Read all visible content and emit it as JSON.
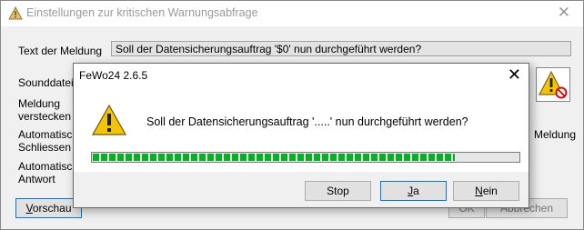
{
  "window": {
    "title": "Einstellungen zur kritischen Warnungsabfrage",
    "close_glyph": "✕",
    "labels": {
      "text_der_meldung": "Text der Meldung",
      "sounddatei": "Sounddatei",
      "meldung_verstecken_1": "Meldung",
      "meldung_verstecken_2": "verstecken",
      "auto_schliessen_1": "Automatische",
      "auto_schliessen_2": "Schliessen",
      "auto_antwort_1": "Automatische",
      "auto_antwort_2": "Antwort",
      "right_meldung": "Meldung"
    },
    "message_text_value": "Soll der Datensicherungsauftrag '$0' nun durchgeführt werden?",
    "buttons": {
      "vorschau_underlined": "V",
      "vorschau_rest": "orschau",
      "ok": "OK",
      "abbrechen": "Abbrechen"
    }
  },
  "dialog": {
    "title": "FeWo24 2.6.5",
    "close_glyph": "✕",
    "message": "Soll der Datensicherungsauftrag '.....' nun durchgeführt werden?",
    "progress_fraction": 0.85,
    "buttons": {
      "stop": "Stop",
      "ja_underlined": "J",
      "ja_rest": "a",
      "nein_underlined": "N",
      "nein_rest": "ein"
    }
  },
  "icons": {
    "title_icon": "warning-icon",
    "dialog_icon": "warning-icon",
    "big_icon": "warning-muted-icon"
  },
  "colors": {
    "progress_green": "#06b025",
    "focus_blue": "#0078d7",
    "warning_yellow": "#f5c400"
  }
}
